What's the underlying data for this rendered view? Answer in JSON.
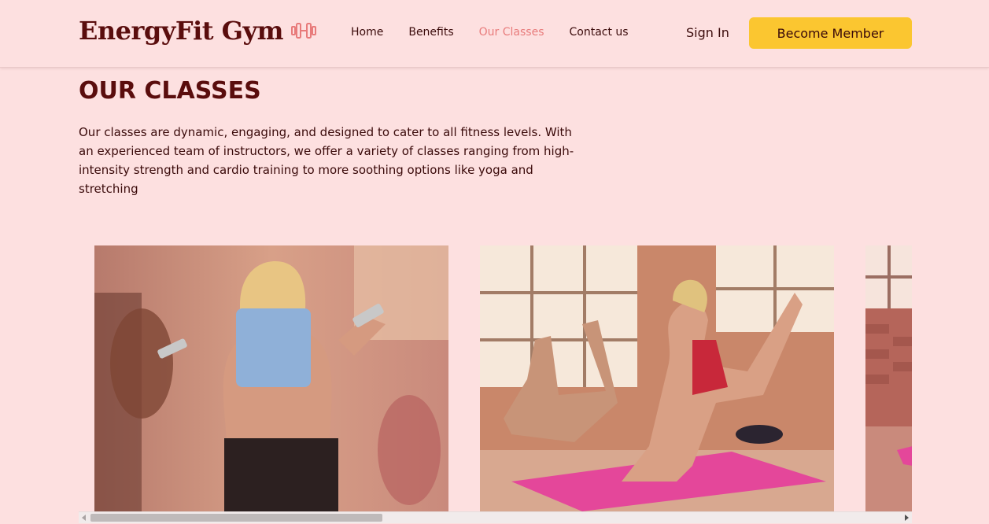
{
  "brand": {
    "name": "EnergyFit Gym",
    "icon": "dumbbell-icon"
  },
  "nav": {
    "items": [
      {
        "label": "Home",
        "active": false
      },
      {
        "label": "Benefits",
        "active": false
      },
      {
        "label": "Our Classes",
        "active": true
      },
      {
        "label": "Contact us",
        "active": false
      }
    ]
  },
  "header": {
    "sign_in": "Sign In",
    "cta": "Become Member"
  },
  "section": {
    "title": "OUR CLASSES",
    "description": "Our classes are dynamic, engaging, and designed to cater to all fitness levels. With an experienced team of instructors, we offer a variety of classes ranging from high-intensity strength and cardio training to more soothing options like yoga and stretching"
  },
  "gallery": {
    "scroll_progress": 0.0,
    "cards": [
      {
        "image": "dumbbell-class-photo"
      },
      {
        "image": "mat-exercise-class-photo"
      },
      {
        "image": "class-photo"
      }
    ]
  },
  "colors": {
    "background": "#fde0e0",
    "brand_dark": "#5a0d0d",
    "accent_pink": "#e87b7b",
    "cta_yellow": "#fbc630"
  }
}
